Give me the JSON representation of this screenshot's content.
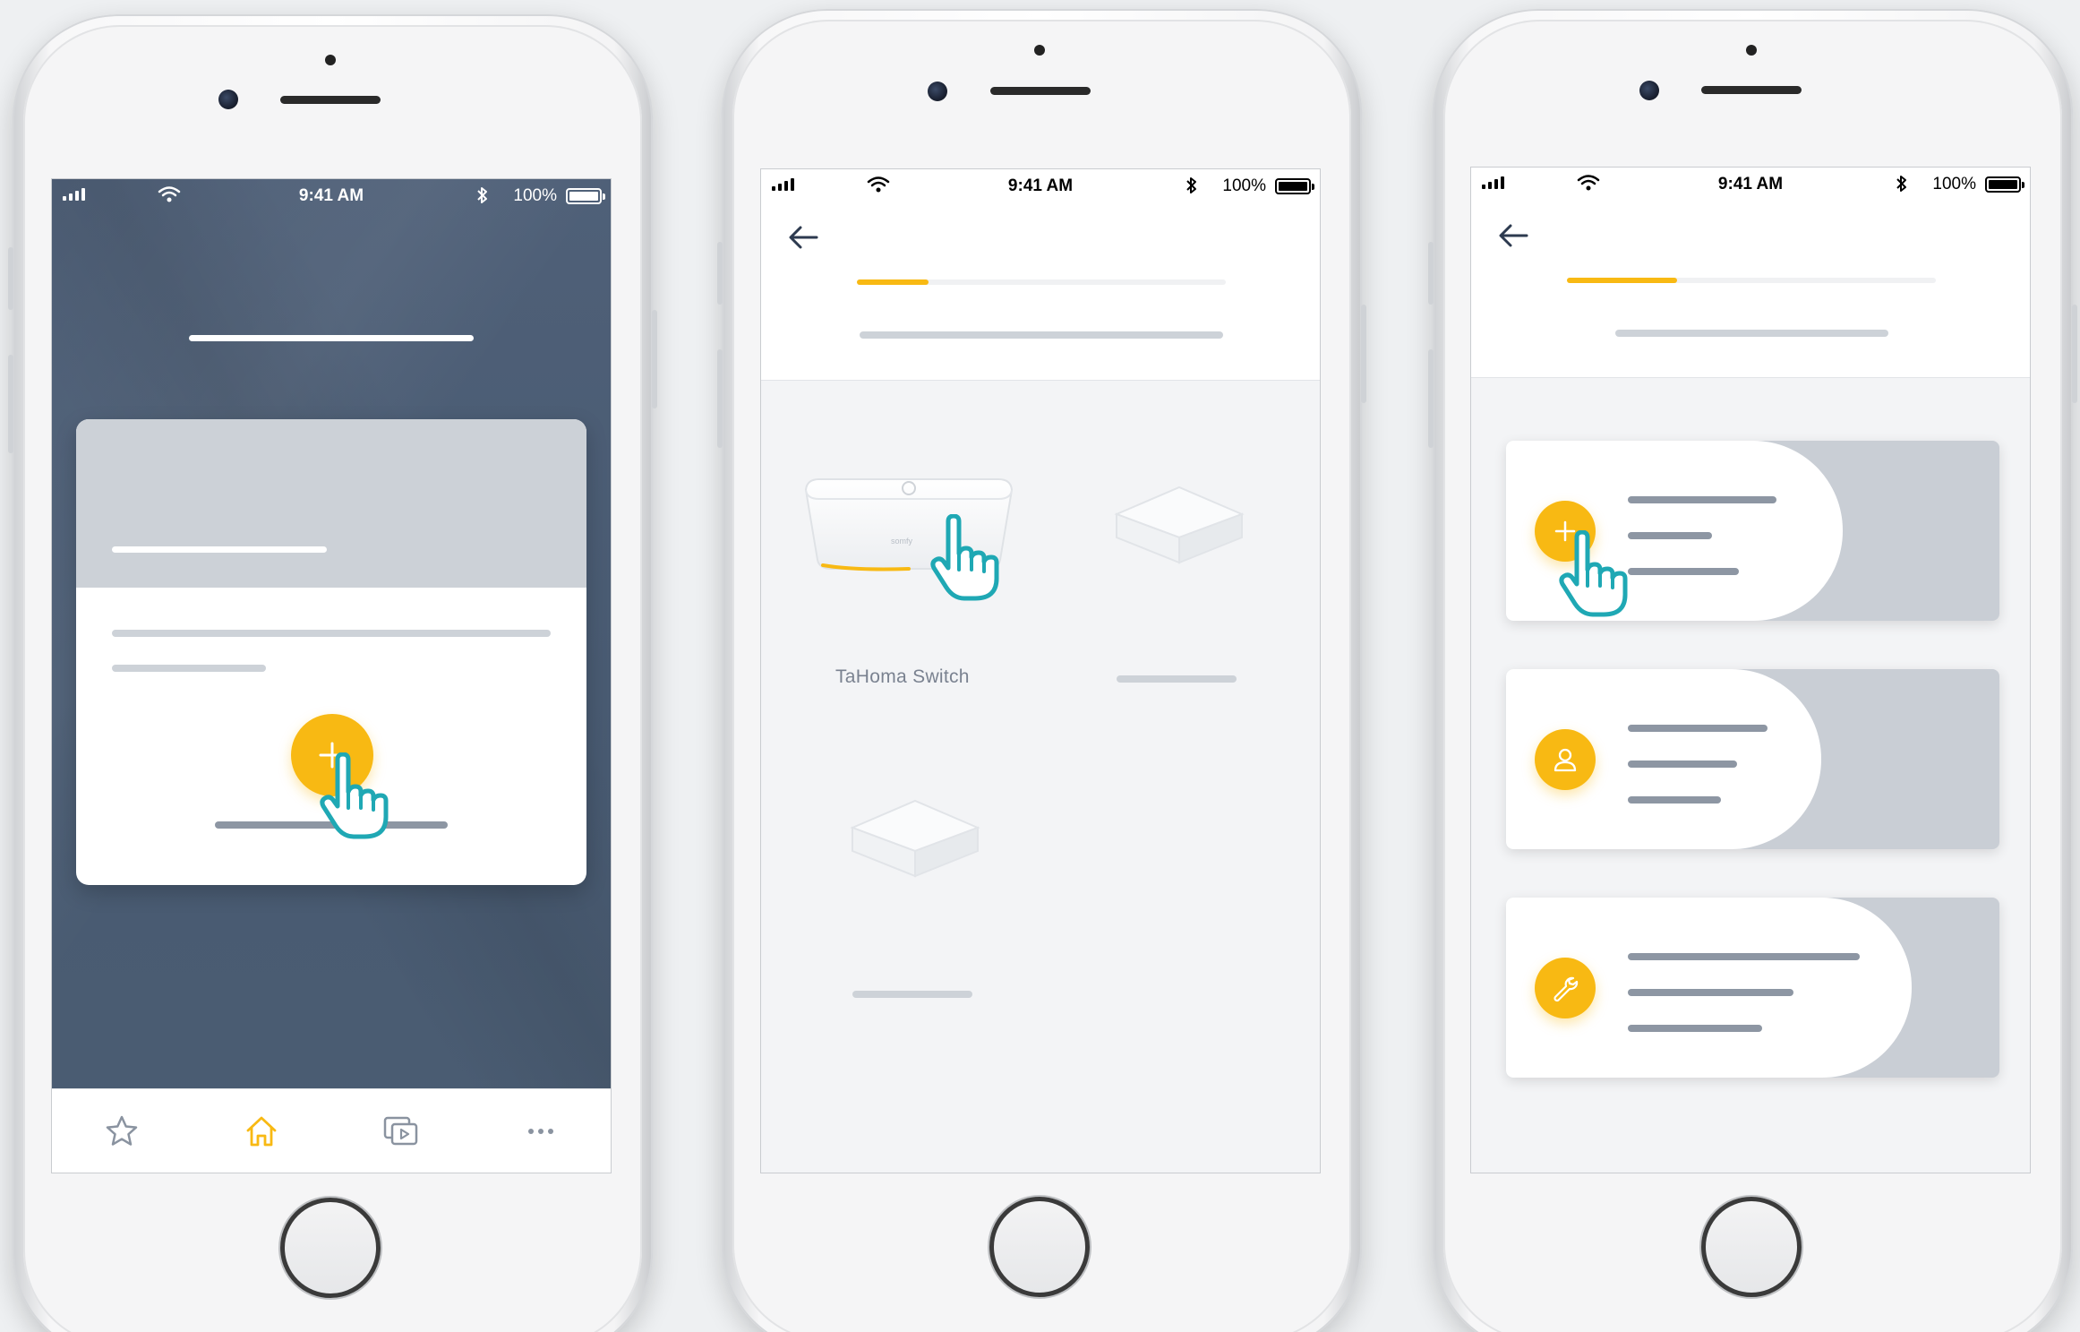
{
  "status_bar": {
    "time": "9:41 AM",
    "battery": "100%"
  },
  "screen2": {
    "devices": [
      {
        "label": "TaHoma Switch"
      }
    ]
  },
  "colors": {
    "accent": "#f8b913",
    "hand": "#1fa8b4",
    "navy": "#4a5b72",
    "placeholder": "#cdd2d8"
  },
  "icons": {
    "tabbar": [
      "star-icon",
      "home-icon",
      "scenarios-icon",
      "more-icon"
    ],
    "options": [
      "plus-icon",
      "user-icon",
      "wrench-icon"
    ]
  }
}
